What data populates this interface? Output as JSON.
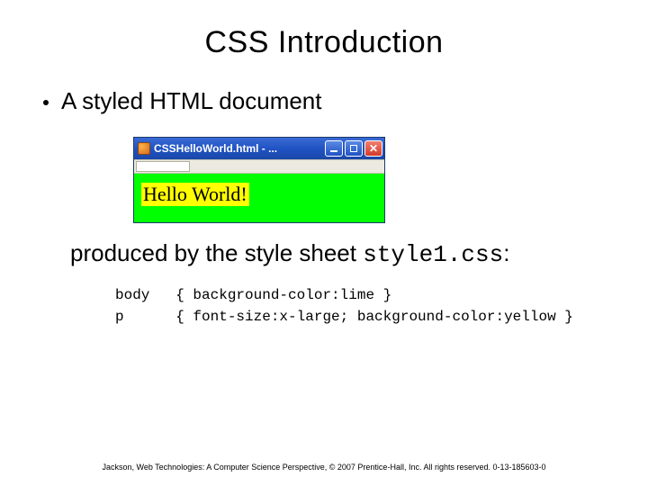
{
  "title": "CSS Introduction",
  "bullet": "A styled HTML document",
  "browser": {
    "titlebar_text": "CSSHelloWorld.html - ...",
    "toolbar_placeholder": " ",
    "content_text": "Hello World!",
    "content_bg": "#00ff00",
    "p_bg": "#ffff00"
  },
  "produced_prefix": "produced by the style sheet ",
  "produced_filename": "style1.css",
  "produced_suffix": ":",
  "code": {
    "line1": "body   { background-color:lime }",
    "line2": "p      { font-size:x-large; background-color:yellow }"
  },
  "footer": "Jackson, Web Technologies: A Computer Science Perspective, © 2007 Prentice-Hall, Inc. All rights reserved. 0-13-185603-0"
}
